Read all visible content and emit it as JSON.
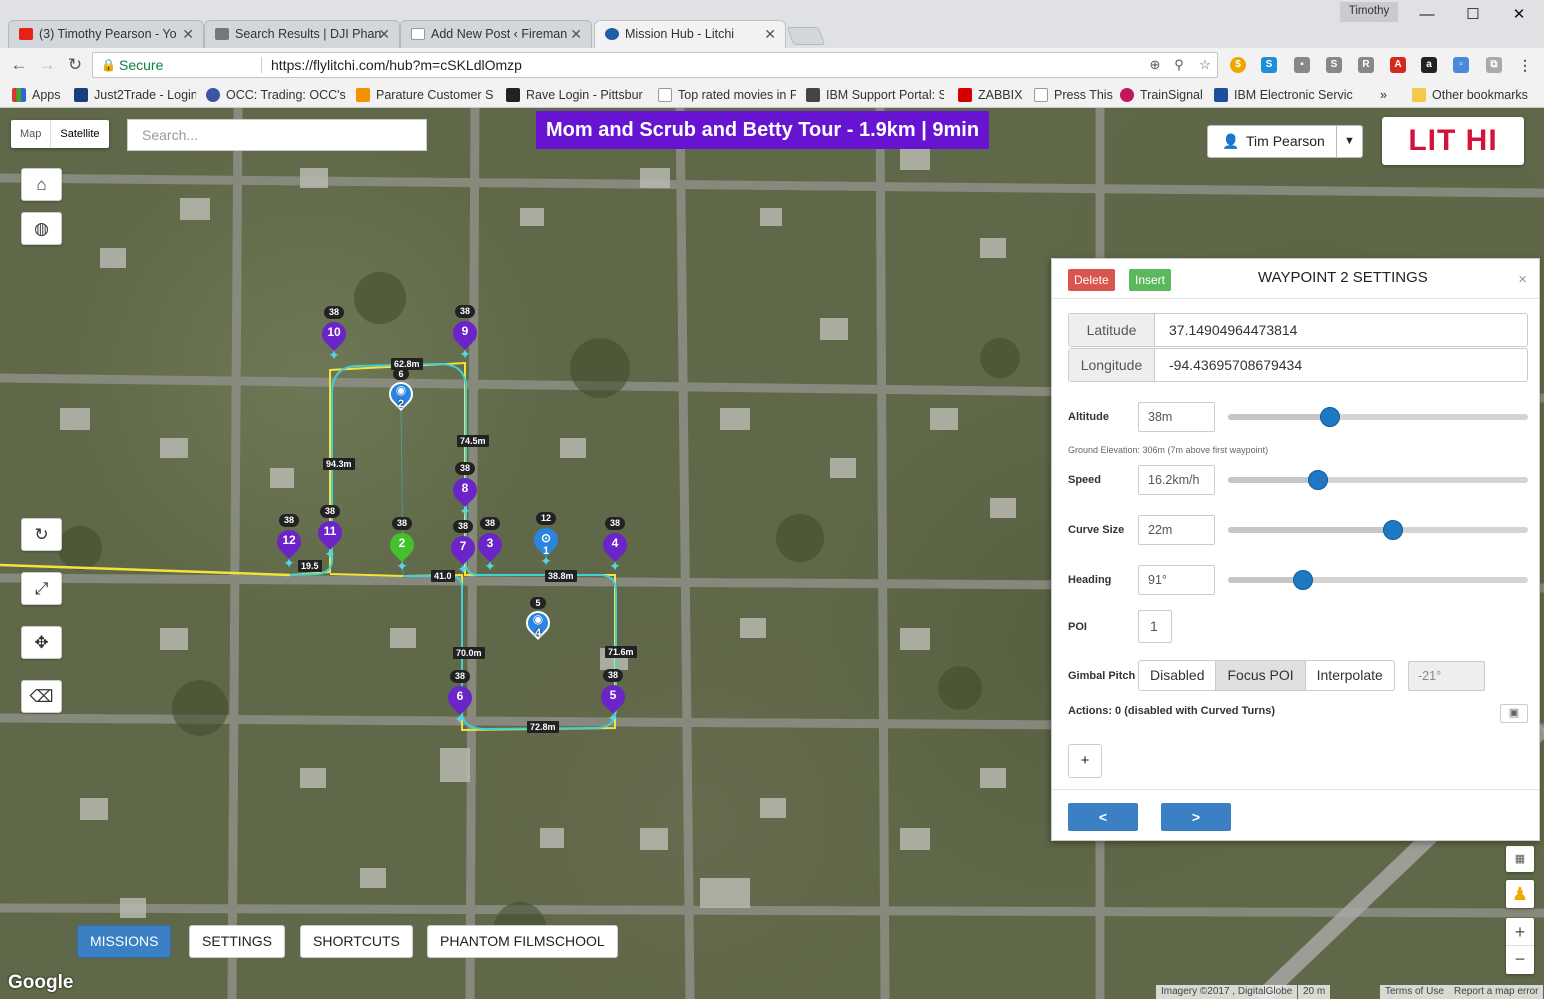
{
  "browser": {
    "user": "Timothy",
    "tabs": [
      {
        "label": "(3) Timothy Pearson - Yo",
        "icon": "youtube-icon",
        "color": "#e62117"
      },
      {
        "label": "Search Results | DJI Phan",
        "icon": "dji-icon",
        "color": "#777777"
      },
      {
        "label": "Add New Post ‹ Fireman",
        "icon": "page-icon",
        "color": "#999999"
      },
      {
        "label": "Mission Hub - Litchi",
        "icon": "litchi-icon",
        "color": "#1f5fa8"
      }
    ],
    "secure_label": "Secure",
    "url": "https://flylitchi.com/hub?m=cSKLdlOmzp",
    "bookmarks": [
      {
        "label": "Apps"
      },
      {
        "label": "Just2Trade - Login"
      },
      {
        "label": "OCC: Trading: OCC's"
      },
      {
        "label": "Parature Customer Se"
      },
      {
        "label": "Rave Login - Pittsbur"
      },
      {
        "label": "Top rated movies in F"
      },
      {
        "label": "IBM Support Portal: S"
      },
      {
        "label": "ZABBIX"
      },
      {
        "label": "Press This"
      },
      {
        "label": "TrainSignal"
      },
      {
        "label": "IBM Electronic Servic"
      }
    ],
    "more_bookmarks": "»",
    "other_bookmarks": "Other bookmarks"
  },
  "map": {
    "map_type_map": "Map",
    "map_type_satellite": "Satellite",
    "search_placeholder": "Search...",
    "mission_title": "Mom and Scrub and Betty Tour - 1.9km | 9min",
    "user_name": "Tim Pearson",
    "logo_text": "LIT HI",
    "bottom_tabs": [
      "MISSIONS",
      "SETTINGS",
      "SHORTCUTS",
      "PHANTOM FILMSCHOOL"
    ],
    "google_label": "Google",
    "attrib_imagery": "Imagery ©2017 , DigitalGlobe",
    "attrib_scale": "20 m",
    "attrib_terms": "Terms of Use",
    "attrib_report": "Report a map error",
    "waypoints": [
      {
        "num": "1",
        "alt": "12",
        "kind": "poi"
      },
      {
        "num": "2",
        "alt": "38",
        "kind": "selected"
      },
      {
        "num": "3",
        "alt": "38",
        "kind": "wp"
      },
      {
        "num": "4",
        "alt": "38",
        "kind": "wp"
      },
      {
        "num": "5",
        "alt": "38",
        "kind": "wp"
      },
      {
        "num": "6",
        "alt": "38",
        "kind": "wp"
      },
      {
        "num": "7",
        "alt": "38",
        "kind": "wp"
      },
      {
        "num": "8",
        "alt": "38",
        "kind": "wp"
      },
      {
        "num": "9",
        "alt": "38",
        "kind": "wp"
      },
      {
        "num": "10",
        "alt": "38",
        "kind": "wp"
      },
      {
        "num": "11",
        "alt": "38",
        "kind": "wp"
      },
      {
        "num": "12",
        "alt": "38",
        "kind": "wp"
      }
    ],
    "pois": [
      {
        "num": "2",
        "alt": "6"
      },
      {
        "num": "4",
        "alt": "5"
      }
    ],
    "distances": [
      "62.8m",
      "74.5m",
      "94.3m",
      "19.5",
      "41.0",
      "38.8m",
      "70.0m",
      "71.6m",
      "72.8m"
    ]
  },
  "panel": {
    "delete_label": "Delete",
    "insert_label": "Insert",
    "title": "WAYPOINT 2 SETTINGS",
    "close": "×",
    "latitude_label": "Latitude",
    "latitude": "37.14904964473814",
    "longitude_label": "Longitude",
    "longitude": "-94.43695708679434",
    "altitude_label": "Altitude",
    "altitude": "38m",
    "altitude_level": 0.34,
    "ground_note": "Ground Elevation: 306m (7m above first waypoint)",
    "speed_label": "Speed",
    "speed": "16.2km/h",
    "speed_level": 0.3,
    "curve_label": "Curve Size",
    "curve": "22m",
    "curve_level": 0.55,
    "heading_label": "Heading",
    "heading": "91°",
    "heading_level": 0.25,
    "poi_label": "POI",
    "poi": "1",
    "gimbal_label": "Gimbal Pitch",
    "gimbal_options": [
      "Disabled",
      "Focus POI",
      "Interpolate"
    ],
    "gimbal_selected": "Focus POI",
    "gimbal_value": "-21°",
    "actions_label": "Actions: 0 (disabled with Curved Turns)",
    "add_label": "+",
    "prev_label": "<",
    "next_label": ">"
  }
}
